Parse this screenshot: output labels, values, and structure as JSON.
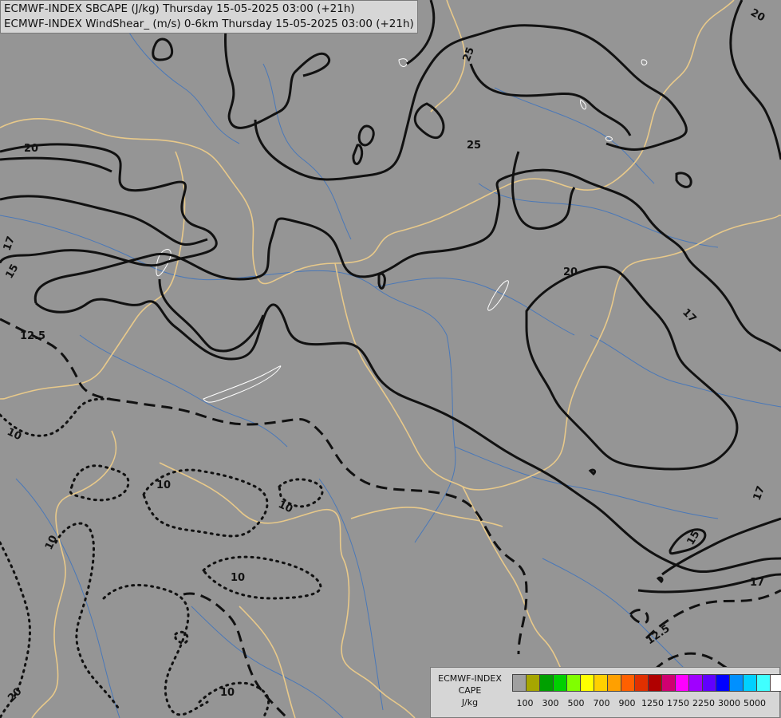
{
  "title_lines": [
    "ECMWF-INDEX SBCAPE (J/kg) Thursday 15-05-2025 03:00 (+21h)",
    "ECMWF-INDEX WindShear_ (m/s) 0-6km Thursday 15-05-2025 03:00 (+21h)"
  ],
  "colors": {
    "background": "#959595",
    "borders": "#e8c98a",
    "rivers": "#4a78b8",
    "contours": "#111111",
    "lakes": "#ffffff"
  },
  "legend": {
    "source_lines": [
      "ECMWF-INDEX",
      "CAPE",
      "J/kg"
    ],
    "colors": [
      "#a0a0a0",
      "#a6a600",
      "#00a000",
      "#00d000",
      "#80ff00",
      "#ffff00",
      "#ffd000",
      "#ffa000",
      "#ff6000",
      "#e03000",
      "#b00000",
      "#d00070",
      "#ff00ff",
      "#a000ff",
      "#6000ff",
      "#0000ff",
      "#0090ff",
      "#00d0ff",
      "#40ffff",
      "#ffffff"
    ],
    "tick_labels": [
      "100",
      "300",
      "500",
      "700",
      "900",
      "1250",
      "1750",
      "2250",
      "3000",
      "5000"
    ]
  },
  "contour_labels": [
    "20",
    "25",
    "25",
    "20",
    "17",
    "15",
    "20",
    "17",
    "12.5",
    "10",
    "10",
    "10",
    "10",
    "10",
    "10",
    "17",
    "15",
    "17",
    "12.5",
    "20"
  ]
}
